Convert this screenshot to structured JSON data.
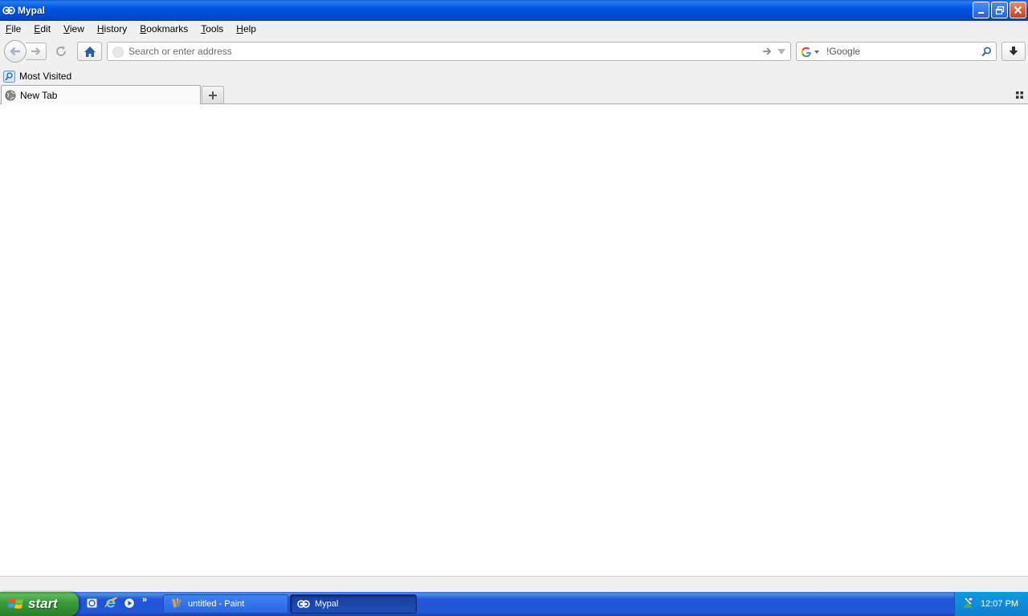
{
  "window": {
    "title": "Mypal"
  },
  "menu": {
    "items": [
      "File",
      "Edit",
      "View",
      "History",
      "Bookmarks",
      "Tools",
      "Help"
    ]
  },
  "navbar": {
    "url_placeholder": "Search or enter address",
    "search_placeholder": "!Google",
    "search_engine": "Google"
  },
  "bookmarks": {
    "items": [
      {
        "label": "Most Visited"
      }
    ]
  },
  "tabs": [
    {
      "label": "New Tab"
    }
  ],
  "taskbar": {
    "start_label": "start",
    "tasks": [
      {
        "label": "untitled - Paint"
      },
      {
        "label": "Mypal"
      }
    ],
    "clock": "12:07 PM"
  },
  "colors": {
    "titlebar": "#0054e3",
    "chrome": "#f0f0f0",
    "taskbar": "#2157d7",
    "start": "#389a38",
    "home_icon": "#2a5ea8"
  }
}
